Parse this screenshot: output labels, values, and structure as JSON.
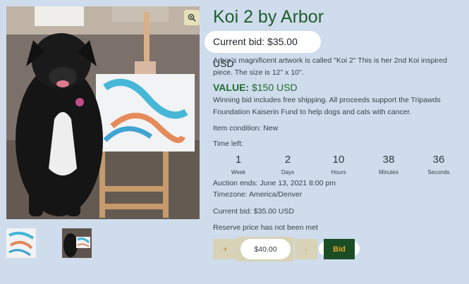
{
  "gallery": {
    "main_image_alt": "Dog sitting next to a Koi painting on an easel",
    "zoom_icon": "zoom-in-icon",
    "thumbnails": [
      "Koi painting close-up",
      "Dog with painting"
    ]
  },
  "product": {
    "title": "Koi 2 by Arbor",
    "current_bid_header": "Current bid: $35.00 USD",
    "description": "Arbor’s magnificent artwork is called \"Koi 2\" This is her 2nd Koi inspired piece. The size is 12\" x 10\".",
    "value_label": "VALUE:",
    "value_amount": "$150 USD",
    "shipping_note": "Winning bid includes free shipping. All proceeds support the Tripawds Foundation Kaiserin Fund to help dogs and cats with cancer.",
    "item_condition": "Item condition: New",
    "time_left_label": "Time left:",
    "countdown": [
      {
        "value": "1",
        "unit": "Week"
      },
      {
        "value": "2",
        "unit": "Days"
      },
      {
        "value": "10",
        "unit": "Hours"
      },
      {
        "value": "38",
        "unit": "Minutes"
      },
      {
        "value": "36",
        "unit": "Seconds"
      }
    ],
    "auction_ends": "Auction ends: June 13, 2021 8:00 pm",
    "timezone": "Timezone: America/Denver",
    "current_bid_footer": "Current bid: $35.00 USD",
    "reserve_note": "Reserve price has not been met"
  },
  "bid_form": {
    "plus_label": "+",
    "amount_value": "$40.00",
    "minus_label": "-",
    "bid_label": "Bid"
  },
  "colors": {
    "background": "#cfdcec",
    "title_green": "#1f5e2c",
    "bid_button": "#1b4d25",
    "bid_text": "#e0a52a"
  }
}
